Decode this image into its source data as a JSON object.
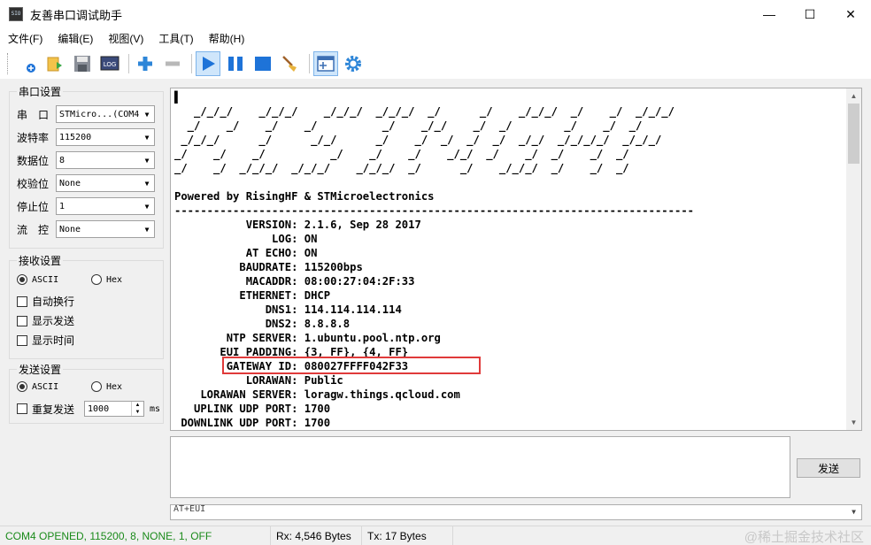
{
  "window": {
    "icon_text": "SIO",
    "title": "友善串口调试助手",
    "minimize": "—",
    "maximize": "☐",
    "close": "✕"
  },
  "menu": [
    "文件(F)",
    "编辑(E)",
    "视图(V)",
    "工具(T)",
    "帮助(H)"
  ],
  "toolbar": {
    "log_label": "LOG"
  },
  "serial_settings": {
    "title": "串口设置",
    "rows": [
      {
        "label": "串　口",
        "value": "STMicro...(COM4"
      },
      {
        "label": "波特率",
        "value": "115200"
      },
      {
        "label": "数据位",
        "value": "8"
      },
      {
        "label": "校验位",
        "value": "None"
      },
      {
        "label": "停止位",
        "value": "1"
      },
      {
        "label": "流　控",
        "value": "None"
      }
    ]
  },
  "receive_settings": {
    "title": "接收设置",
    "ascii": "ASCII",
    "hex": "Hex",
    "options": [
      "自动换行",
      "显示发送",
      "显示时间"
    ]
  },
  "send_settings": {
    "title": "发送设置",
    "ascii": "ASCII",
    "hex": "Hex",
    "repeat_label": "重复发送",
    "interval": "1000",
    "unit": "ms"
  },
  "receive_lines": [
    "▌",
    "   _/_/_/    _/_/_/    _/_/_/  _/_/_/  _/      _/    _/_/_/  _/    _/  _/_/_/",
    "  _/    _/    _/    _/          _/    _/_/    _/  _/        _/    _/  _/",
    " _/_/_/      _/      _/_/      _/    _/  _/  _/  _/  _/_/  _/_/_/_/  _/_/_/",
    "_/    _/    _/          _/    _/    _/    _/_/  _/    _/  _/    _/  _/",
    "_/    _/  _/_/_/  _/_/_/    _/_/_/  _/      _/    _/_/_/  _/    _/  _/",
    "",
    "Powered by RisingHF & STMicroelectronics",
    "--------------------------------------------------------------------------------",
    "           VERSION: 2.1.6, Sep 28 2017",
    "               LOG: ON",
    "           AT ECHO: ON",
    "          BAUDRATE: 115200bps",
    "           MACADDR: 08:00:27:04:2F:33",
    "          ETHERNET: DHCP",
    "              DNS1: 114.114.114.114",
    "              DNS2: 8.8.8.8",
    "        NTP SERVER: 1.ubuntu.pool.ntp.org",
    "       EUI PADDING: {3, FF}, {4, FF}",
    "        GATEWAY ID: 080027FFFF042F33",
    "           LORAWAN: Public",
    "    LORAWAN SERVER: loragw.things.qcloud.com",
    "   UPLINK UDP PORT: 1700",
    " DOWNLINK UDP PORT: 1700"
  ],
  "send": {
    "button": "发送",
    "history": "AT+EUI"
  },
  "status": {
    "port": "COM4 OPENED, 115200, 8, NONE, 1, OFF",
    "rx": "Rx: 4,546 Bytes",
    "tx": "Tx: 17 Bytes"
  },
  "watermark": "@稀土掘金技术社区",
  "colors": {
    "status_text": "#1a8a1a",
    "highlight": "#e03a3a",
    "toolbar_blue": "#1e73d8"
  }
}
